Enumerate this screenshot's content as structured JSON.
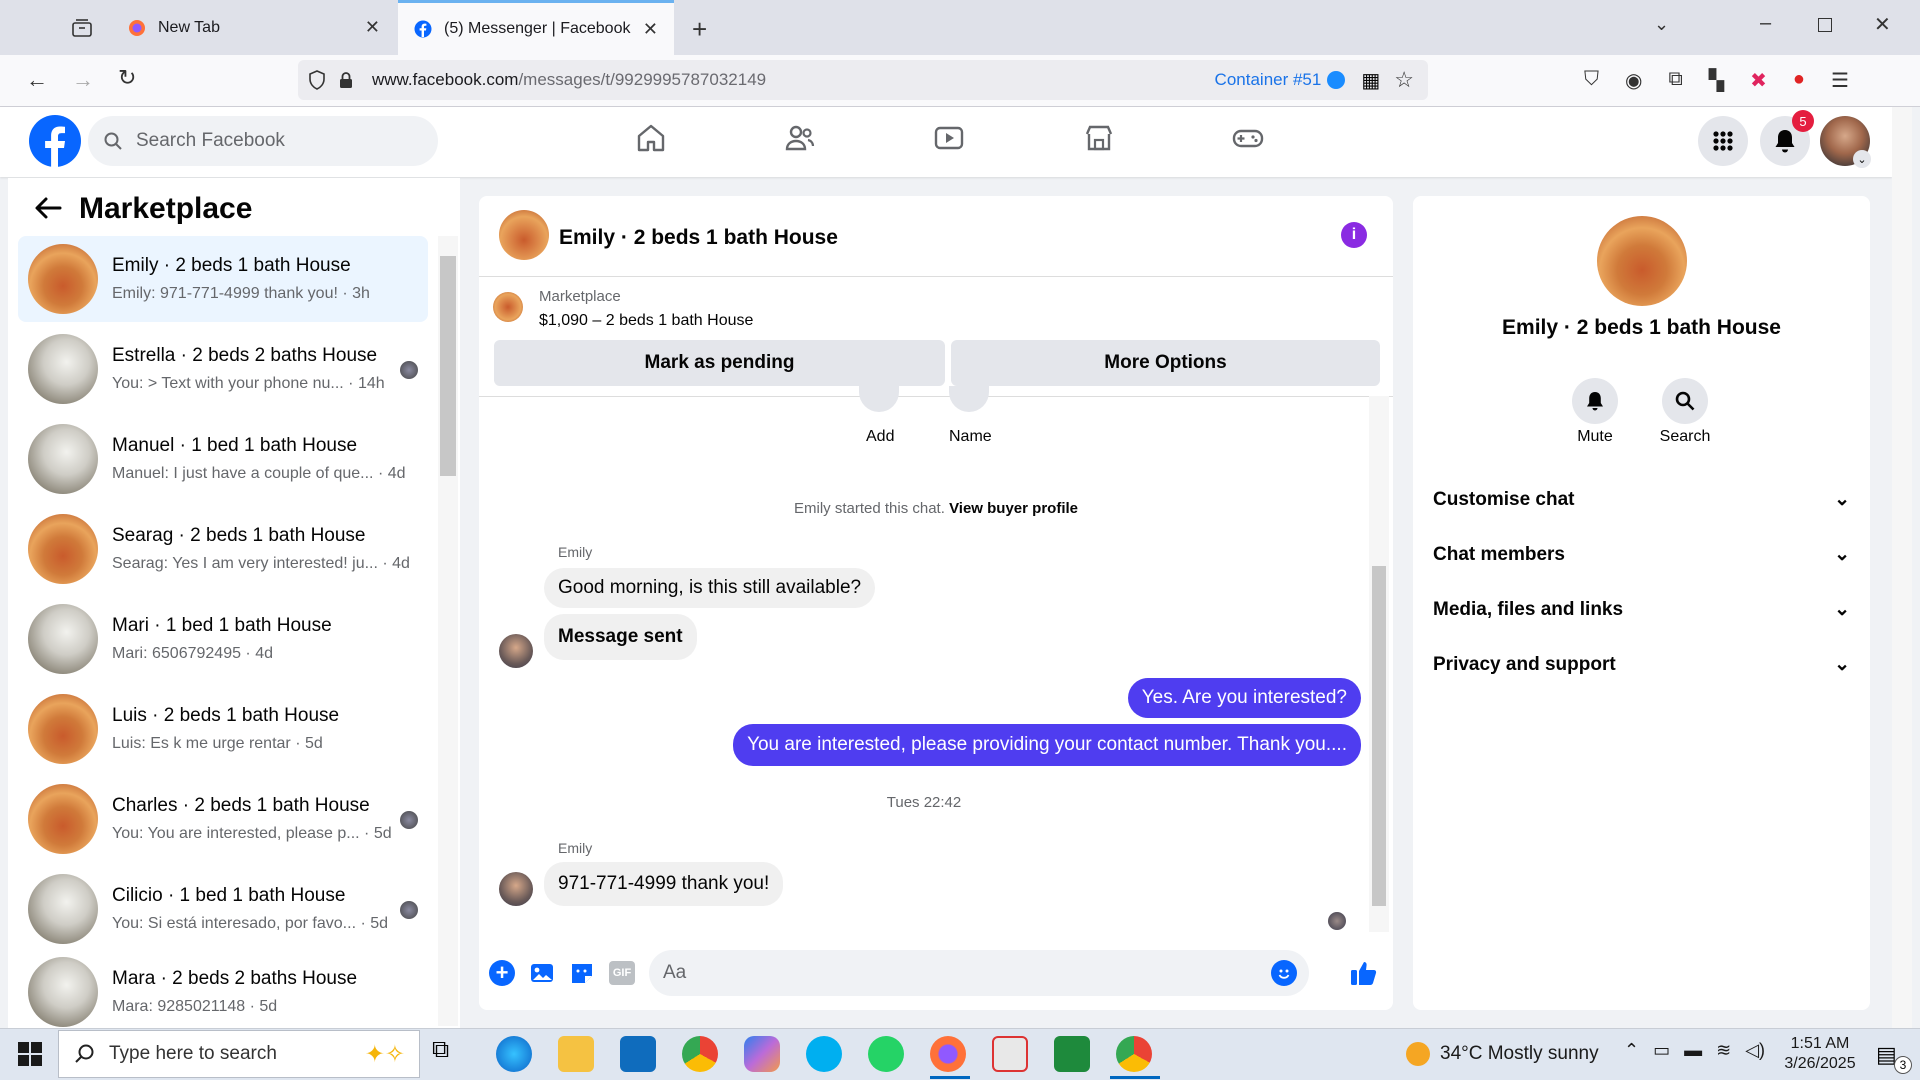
{
  "browser": {
    "tabs": [
      {
        "label": "New Tab"
      },
      {
        "label": "(5) Messenger | Facebook"
      }
    ],
    "url_domain": "www.facebook.com",
    "url_path": "/messages/t/9929995787032149",
    "container_label": "Container #51",
    "accent": "#1a73e8"
  },
  "fb": {
    "search_placeholder": "Search Facebook",
    "notification_count": "5",
    "brand_color": "#0866ff"
  },
  "sidebar": {
    "title": "Marketplace",
    "conversations": [
      {
        "title": "Emily · 2 beds 1 bath House",
        "subtitle": "Emily: 971-771-4999 thank you! · 3h",
        "thumb": "red"
      },
      {
        "title": "Estrella · 2 beds 2 baths House",
        "subtitle": "You: > Text with your phone nu... · 14h",
        "thumb": "grey"
      },
      {
        "title": "Manuel · 1 bed 1 bath House",
        "subtitle": "Manuel: I just have a couple of que... · 4d",
        "thumb": "grey"
      },
      {
        "title": "Searag · 2 beds 1 bath House",
        "subtitle": "Searag: Yes I am very interested! ju... · 4d",
        "thumb": "red"
      },
      {
        "title": "Mari · 1 bed 1 bath House",
        "subtitle": "Mari: 6506792495 · 4d",
        "thumb": "grey"
      },
      {
        "title": "Luis · 2 beds 1 bath House",
        "subtitle": "Luis: Es k me urge rentar · 5d",
        "thumb": "red"
      },
      {
        "title": "Charles · 2 beds 1 bath House",
        "subtitle": "You: You are interested, please p... · 5d",
        "thumb": "red"
      },
      {
        "title": "Cilicio · 1 bed 1 bath House",
        "subtitle": "You: Si está interesado, por favo... · 5d",
        "thumb": "grey"
      },
      {
        "title": "Mara · 2 beds 2 baths House",
        "subtitle": "Mara: 9285021148 · 5d",
        "thumb": "grey"
      }
    ]
  },
  "chat": {
    "header_title": "Emily · 2 beds 1 bath House",
    "listing_source": "Marketplace",
    "listing_price_title": "$1,090 – 2 beds 1 bath House",
    "mark_pending_label": "Mark as pending",
    "more_options_label": "More Options",
    "add_label": "Add",
    "name_label": "Name",
    "started_text": "Emily started this chat.",
    "view_profile_label": "View buyer profile",
    "sender_name": "Emily",
    "sender_name_2": "Emily",
    "msg1": "Good morning, is this still available?",
    "msg2": "Message sent",
    "msg3": "Yes. Are you interested?",
    "msg4": "You are interested, please providing your contact number. Thank you....",
    "timestamp": "Tues 22:42",
    "msg5": "971-771-4999 thank you!",
    "composer_placeholder": "Aa",
    "gif_label": "GIF",
    "outgoing_color": "#4f3df0"
  },
  "info": {
    "title": "Emily · 2 beds 1 bath House",
    "mute_label": "Mute",
    "search_label": "Search",
    "sections": [
      "Customise chat",
      "Chat members",
      "Media, files and links",
      "Privacy and support"
    ]
  },
  "taskbar": {
    "search_placeholder": "Type here to search",
    "weather": "34°C  Mostly sunny",
    "time": "1:51 AM",
    "date": "3/26/2025",
    "notif_count": "3"
  }
}
